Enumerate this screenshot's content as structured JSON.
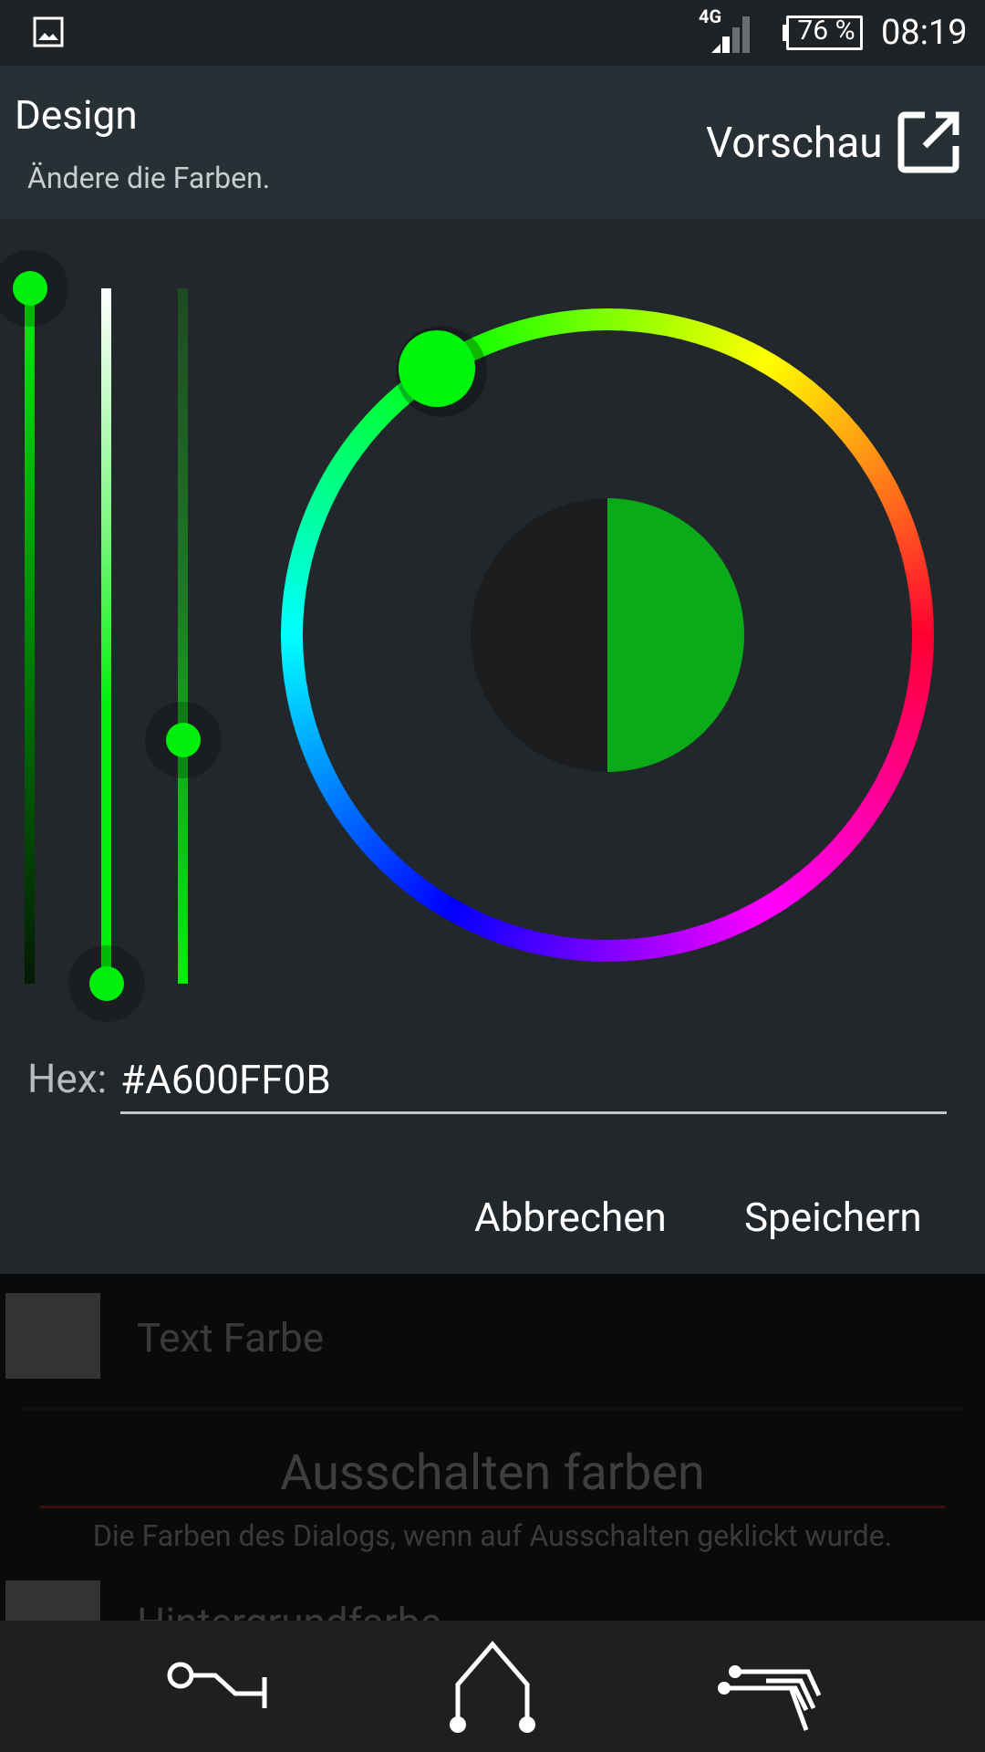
{
  "status_bar": {
    "network_type": "4G",
    "battery": "76 %",
    "time": "08:19"
  },
  "dialog": {
    "title": "Design",
    "subtitle": "Ändere die Farben.",
    "preview_label": "Vorschau",
    "hex_label": "Hex:",
    "hex_value": "#A600FF0B",
    "cancel_label": "Abbrechen",
    "save_label": "Speichern",
    "selected_color": "#0BAA18",
    "accent_color": "#00EF0C"
  },
  "background_list": {
    "text_color_label": "Text Farbe",
    "power_off_title": "Ausschalten farben",
    "power_off_description": "Die Farben des Dialogs, wenn auf Ausschalten geklickt wurde.",
    "background_color_label": "Hintergrundfarbe"
  },
  "icons": {
    "status_image": "image-icon",
    "signal": "signal-icon",
    "battery": "battery-icon",
    "preview": "open-external-icon",
    "nav_back": "back-icon",
    "nav_home": "home-icon",
    "nav_recent": "recent-apps-icon"
  }
}
